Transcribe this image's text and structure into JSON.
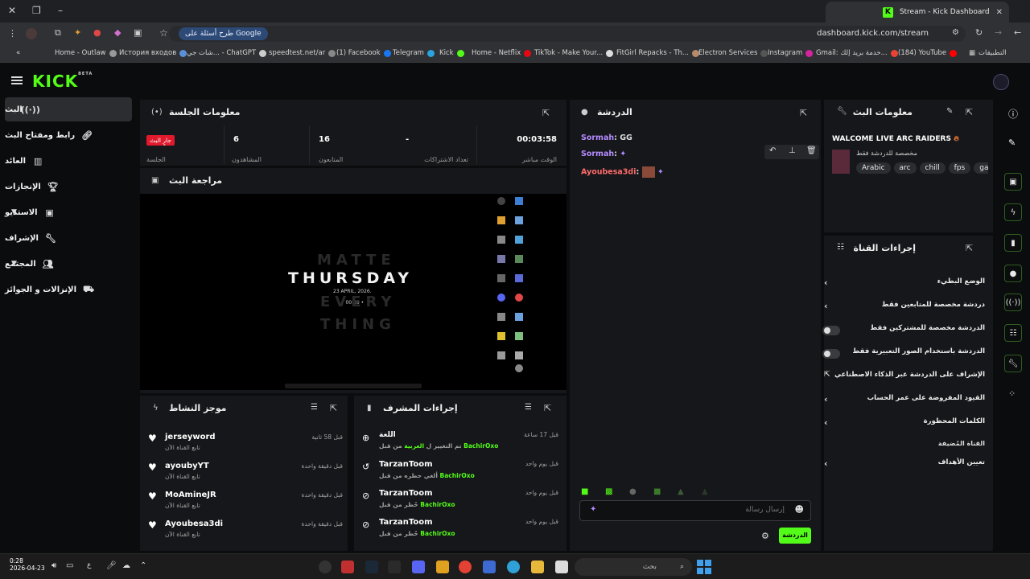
{
  "browser": {
    "tab_title": "Stream - Kick Dashboard",
    "url": "dashboard.kick.com/stream",
    "google_pill": "طرح أسئلة على Google",
    "bookmarks": [
      "Home - Outlaw",
      "История входов",
      "شات جي... - ChatGPT",
      "speedtest.net/ar",
      "(1) Facebook",
      "Telegram",
      "Kick",
      "Home - Netflix",
      "TikTok - Make Your...",
      "FitGirl Repacks - Th...",
      "Electron Services",
      "Instagram",
      "Gmail: خدمة بريد إلك...",
      "(184) YouTube",
      "التطبيقات"
    ]
  },
  "sidebar": {
    "items": [
      {
        "label": "البث",
        "icon": "broadcast-icon"
      },
      {
        "label": "رابط ومفتاح البث",
        "icon": "link-icon"
      },
      {
        "label": "العائد",
        "icon": "chart-icon"
      },
      {
        "label": "الإنجازات",
        "icon": "trophy-icon"
      },
      {
        "label": "الاستديو",
        "icon": "studio-icon"
      },
      {
        "label": "الإشراف",
        "icon": "wrench-icon"
      },
      {
        "label": "المجتمع",
        "icon": "community-icon"
      },
      {
        "label": "الإنزالات و الجوائز",
        "icon": "drops-icon"
      }
    ]
  },
  "session": {
    "title": "معلومات الجلسة",
    "live_badge": "جارٍ البث",
    "session_label": "الجلسة",
    "viewers_value": "6",
    "viewers_label": "المشاهدون",
    "followers_value": "16",
    "followers_label": "المتابعون",
    "subs_value": "-",
    "subs_label": "تعداد الاشتراكات",
    "uptime_value": "00:03:58",
    "uptime_label": "الوقت مباشر"
  },
  "preview": {
    "title": "مراجعة البث",
    "line1": "MATTE",
    "line2": "THURSDAY",
    "line3": "EVERY",
    "line4": "THING",
    "date": "23 APRIL, 2026.",
    "time": "• 00:26 •"
  },
  "activity": {
    "title": "موجز النشاط",
    "items": [
      {
        "name": "jerseyword",
        "sub": "تابع القناة الآن",
        "time": "قبل 58 ثانية"
      },
      {
        "name": "ayoubyYT",
        "sub": "تابع القناة الآن",
        "time": "قبل دقيقة واحدة"
      },
      {
        "name": "MoAmineJR",
        "sub": "تابع القناة الآن",
        "time": "قبل دقيقة واحدة"
      },
      {
        "name": "Ayoubesa3di",
        "sub": "تابع القناة الآن",
        "time": "قبل دقيقة واحدة"
      }
    ]
  },
  "modactions": {
    "title": "إجراءات المشرف",
    "items": [
      {
        "name": "اللغة",
        "pre": "تم التغيير ل ",
        "hl": "العربية",
        "post": " من قبل ",
        "by": "BachirOxo",
        "time": "قبل 17 ساعة"
      },
      {
        "name": "TarzanToom",
        "pre": "ألغي حظره من قبل ",
        "hl": "",
        "post": "",
        "by": "BachirOxo",
        "time": "قبل يوم واحد"
      },
      {
        "name": "TarzanToom",
        "pre": "حُظر من قبل ",
        "hl": "",
        "post": "",
        "by": "BachirOxo",
        "time": "قبل يوم واحد"
      },
      {
        "name": "TarzanToom",
        "pre": "حُظر من قبل ",
        "hl": "",
        "post": "",
        "by": "BachirOxo",
        "time": "قبل يوم واحد"
      }
    ]
  },
  "chat": {
    "title": "الدردشة",
    "messages": [
      {
        "user": "Sormah",
        "text": ": GG"
      },
      {
        "user": "Sormah",
        "text": ":"
      },
      {
        "user": "Ayoubesa3di",
        "text": ":"
      }
    ],
    "placeholder": "إرسال رسالة",
    "send_label": "الدردشة"
  },
  "streaminfo": {
    "title": "معلومات البث",
    "stream_title": "WALCOME LIVE ARC RAIDERS",
    "subtitle": "مخصصة للدردشة فقط",
    "tags": [
      "Arabic",
      "arc",
      "chill",
      "fps",
      "gam"
    ]
  },
  "channelactions": {
    "title": "إجراءات القناة",
    "slow_mode": "الوضع البطيء",
    "followers_only": "دردشة مخصصة للمتابعين فقط",
    "subs_only": "الدردشة مخصصة للمشتركين فقط",
    "emotes_only": "الدردشة باستخدام الصور التعبيرية فقط",
    "ai_mod": "الإشراف على الدردشة عبر الذكاء الاصطناعي",
    "account_age": "القيود المفروضة على عمر الحساب",
    "banned_words": "الكلمات المحظورة",
    "host_section": "القناة المُضيفة",
    "set_goals": "تعيين الأهداف"
  },
  "taskbar": {
    "search": "بحث",
    "clock_time": "0:28",
    "clock_date": "2026-04-23",
    "lang": "ع"
  }
}
